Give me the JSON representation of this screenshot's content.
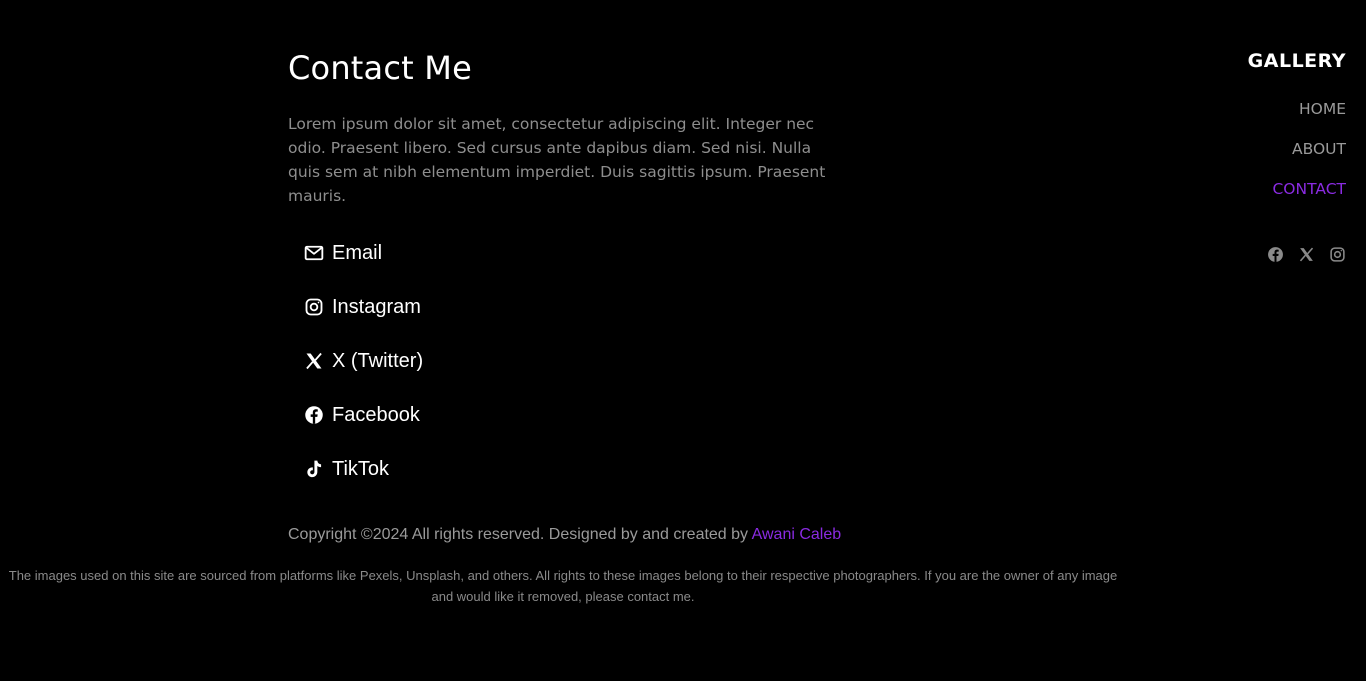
{
  "main": {
    "title": "Contact Me",
    "intro": "Lorem ipsum dolor sit amet, consectetur adipiscing elit. Integer nec odio. Praesent libero. Sed cursus ante dapibus diam. Sed nisi. Nulla quis sem at nibh elementum imperdiet. Duis sagittis ipsum. Praesent mauris.",
    "contacts": [
      {
        "label": "Email",
        "icon": "envelope-icon"
      },
      {
        "label": "Instagram",
        "icon": "instagram-icon"
      },
      {
        "label": "X (Twitter)",
        "icon": "x-twitter-icon"
      },
      {
        "label": "Facebook",
        "icon": "facebook-icon"
      },
      {
        "label": "TikTok",
        "icon": "tiktok-icon"
      }
    ]
  },
  "sidebar": {
    "brand": "GALLERY",
    "nav": [
      {
        "label": "HOME"
      },
      {
        "label": "ABOUT"
      },
      {
        "label": "CONTACT"
      }
    ],
    "social_icons": [
      "facebook-icon",
      "x-twitter-icon",
      "instagram-icon"
    ]
  },
  "footer": {
    "copyright_prefix": "Copyright ©2024 All rights reserved. Designed by and created by ",
    "author": "Awani Caleb",
    "disclaimer": "The images used on this site are sourced from platforms like Pexels, Unsplash, and others. All rights to these images belong to their respective photographers. If you are the owner of any image and would like it removed, please contact me."
  },
  "colors": {
    "background": "#000000",
    "accent": "#8a2be2",
    "text_muted": "#8e8e8e"
  }
}
